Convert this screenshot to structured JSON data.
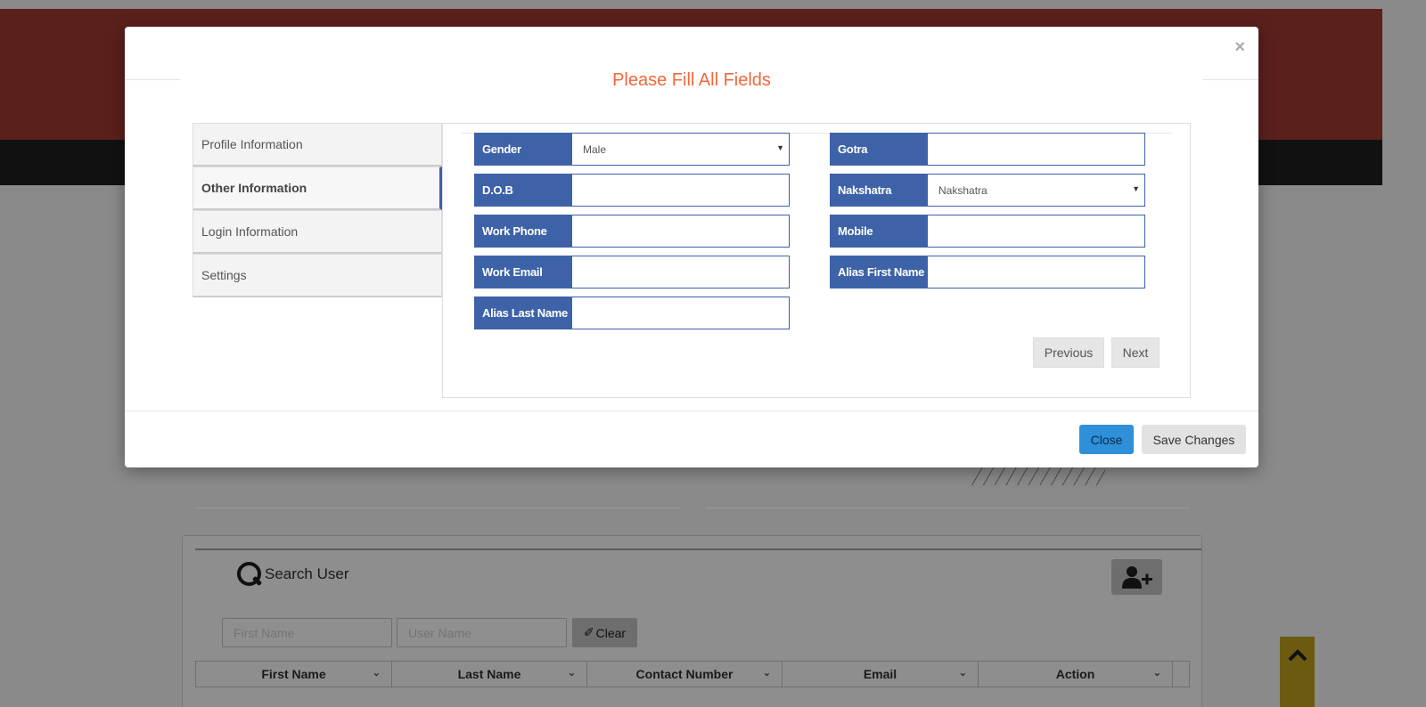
{
  "modal": {
    "close_symbol": "×",
    "title": "Please Fill All Fields",
    "close_button": "Close",
    "save_button": "Save Changes"
  },
  "tabs": [
    {
      "label": "Profile Information",
      "active": false
    },
    {
      "label": "Other Information",
      "active": true
    },
    {
      "label": "Login Information",
      "active": false
    },
    {
      "label": "Settings",
      "active": false
    }
  ],
  "form": {
    "gender": {
      "label": "Gender",
      "value": "Male"
    },
    "gotra": {
      "label": "Gotra",
      "value": ""
    },
    "dob": {
      "label": "D.O.B",
      "value": ""
    },
    "nakshatra": {
      "label": "Nakshatra",
      "value": "Nakshatra"
    },
    "work_phone": {
      "label": "Work Phone",
      "value": ""
    },
    "mobile": {
      "label": "Mobile",
      "value": ""
    },
    "work_email": {
      "label": "Work Email",
      "value": ""
    },
    "alias_first_name": {
      "label": "Alias First Name",
      "value": ""
    },
    "alias_last_name": {
      "label": "Alias Last Name",
      "value": ""
    },
    "previous": "Previous",
    "next": "Next"
  },
  "background": {
    "search_title": "Search User",
    "first_name_placeholder": "First Name",
    "user_name_placeholder": "User Name",
    "clear_label": "Clear",
    "grid_columns": [
      "First Name",
      "Last Name",
      "Contact Number",
      "Email",
      "Action"
    ]
  },
  "colors": {
    "accent_blue": "#3d62a8",
    "title_orange": "#f1683a",
    "close_button_blue": "#2e90d8",
    "header_red": "#c0392b"
  }
}
